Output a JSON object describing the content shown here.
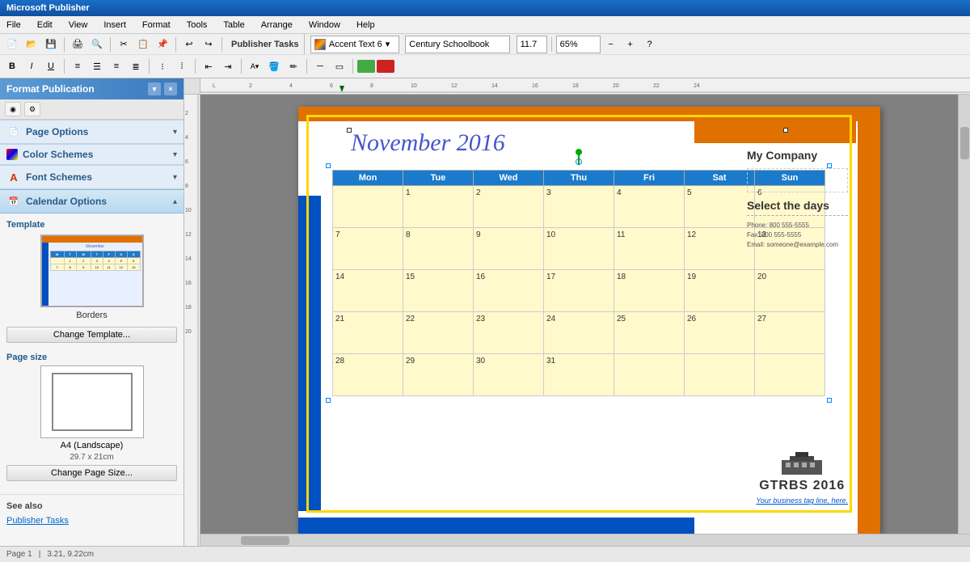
{
  "titlebar": {
    "text": "Microsoft Publisher"
  },
  "menubar": {
    "items": [
      "File",
      "Edit",
      "View",
      "Insert",
      "Format",
      "Tools",
      "Table",
      "Arrange",
      "Window",
      "Help"
    ]
  },
  "toolbar1": {
    "publisher_tasks": "Publisher Tasks",
    "accent_text": "Accent Text 6",
    "font_name": "Century Schoolbook",
    "font_size": "11.7",
    "zoom": "65%"
  },
  "toolbar2": {
    "bold": "B",
    "italic": "I",
    "underline": "U"
  },
  "sidebar": {
    "title": "Format Publication",
    "close_btn": "×",
    "sections": [
      {
        "id": "page-options",
        "label": "Page Options",
        "icon": "📄"
      },
      {
        "id": "color-schemes",
        "label": "Color Schemes",
        "icon": "🎨"
      },
      {
        "id": "font-schemes",
        "label": "Font Schemes",
        "icon": "A"
      }
    ],
    "calendar_options": {
      "label": "Calendar Options"
    },
    "template": {
      "label": "Template",
      "name": "Borders",
      "change_btn": "Change Template..."
    },
    "page_size": {
      "label": "Page size",
      "name": "A4 (Landscape)",
      "dims": "29.7 x 21cm",
      "change_btn": "Change Page Size..."
    },
    "see_also": {
      "label": "See also",
      "links": [
        "Publisher Tasks"
      ]
    }
  },
  "calendar": {
    "title": "November 2016",
    "headers": [
      "Mon",
      "Tue",
      "Wed",
      "Thu",
      "Fri",
      "Sat",
      "Sun"
    ],
    "rows": [
      [
        "",
        "1",
        "2",
        "3",
        "4",
        "5",
        "6"
      ],
      [
        "7",
        "8",
        "9",
        "10",
        "11",
        "12",
        "13"
      ],
      [
        "14",
        "15",
        "16",
        "17",
        "18",
        "19",
        "20"
      ],
      [
        "21",
        "22",
        "23",
        "24",
        "25",
        "26",
        "27"
      ],
      [
        "28",
        "29",
        "30",
        "31",
        "",
        "",
        ""
      ]
    ],
    "company": "My Company",
    "select_days": "Select the days",
    "contact": {
      "phone": "Phone: 800 555-5555",
      "fax": "Fax: 800 555-5555",
      "email": "Email: someone@example.com"
    },
    "logo": "GTRBS 2016",
    "tagline": "Your business tag line, here."
  },
  "statusbar": {
    "page_info": "Page 1",
    "position": "3.21, 9.22cm"
  }
}
